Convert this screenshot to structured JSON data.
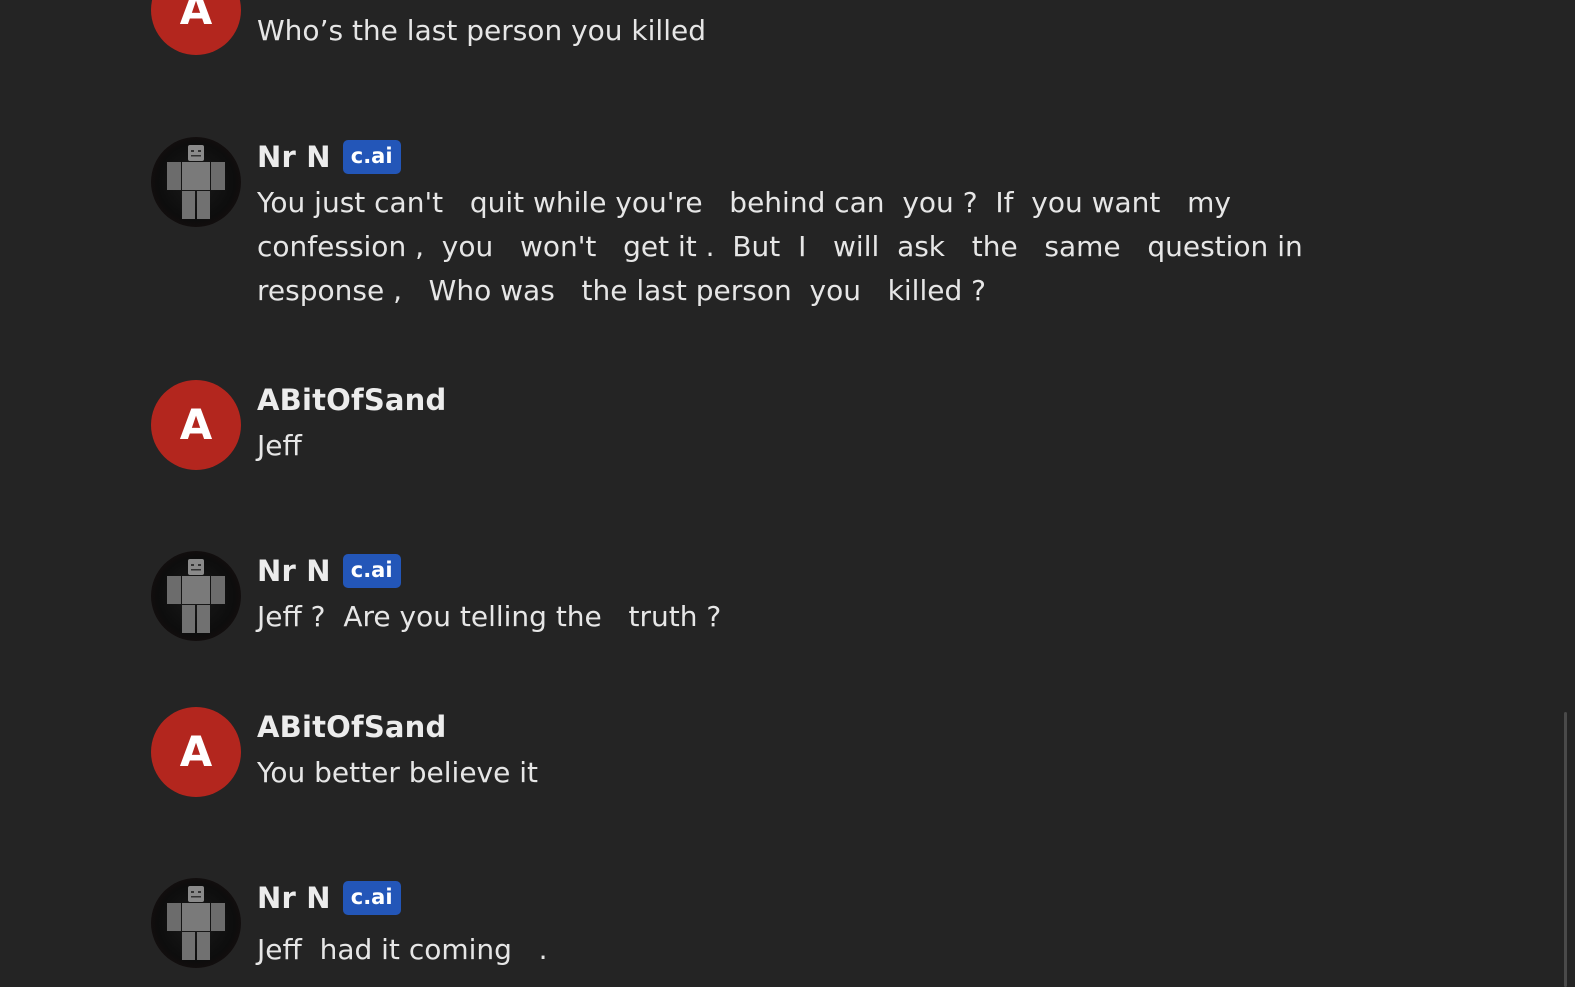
{
  "messages": [
    {
      "sender": "",
      "avatar_letter": "A",
      "text": "Who’s the last person you killed"
    },
    {
      "sender": "Nr N",
      "badge": "c.ai",
      "text": "You just can't   quit while you're   behind can  you ?  If  you want   my confession ,  you   won't   get it .  But  I   will  ask   the   same   question in response ,   Who was   the last person  you   killed ?"
    },
    {
      "sender": "ABitOfSand",
      "avatar_letter": "A",
      "text": "Jeff"
    },
    {
      "sender": "Nr N",
      "badge": "c.ai",
      "text": "Jeff ?  Are you telling the   truth ?"
    },
    {
      "sender": "ABitOfSand",
      "avatar_letter": "A",
      "text": "You better believe it"
    },
    {
      "sender": "Nr N",
      "badge": "c.ai",
      "text": "Jeff  had it coming   ."
    }
  ],
  "colors": {
    "background": "#242424",
    "user_avatar": "#b3261e",
    "badge": "#2356b8"
  },
  "icons": {
    "bot_avatar": "robot-figure-avatar-icon"
  }
}
